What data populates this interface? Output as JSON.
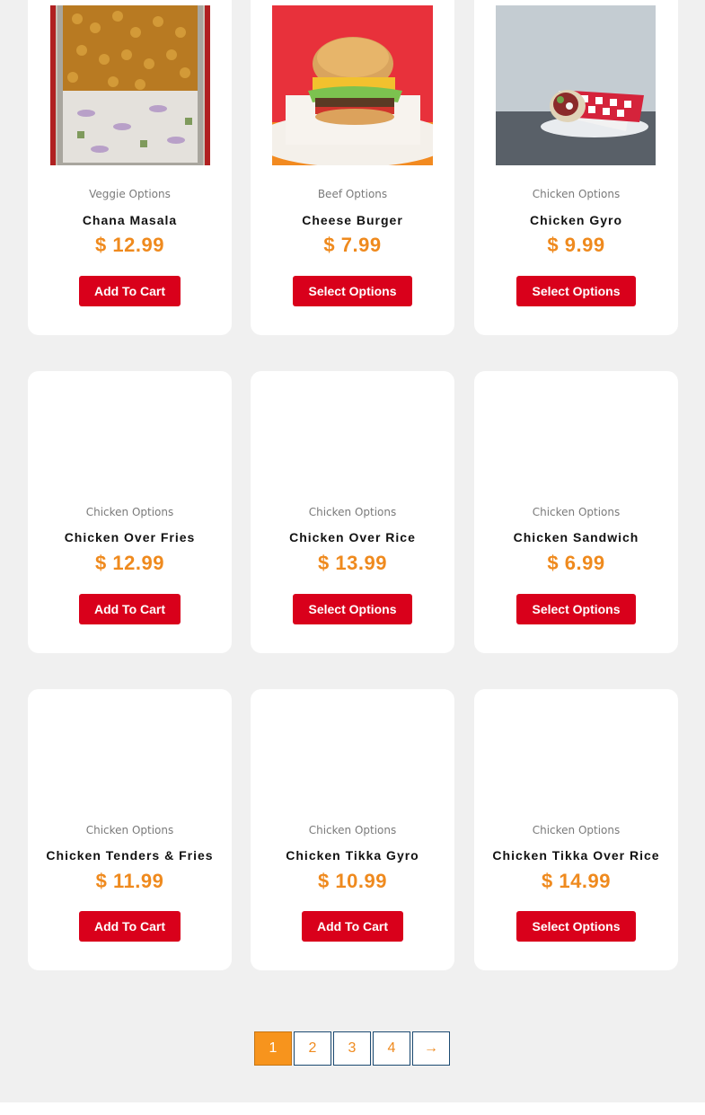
{
  "products": [
    {
      "category": "Veggie Options",
      "name": "Chana Masala",
      "price": "$ 12.99",
      "button": "Add To Cart",
      "button_type": "add",
      "image": "chana-masala-photo"
    },
    {
      "category": "Beef Options",
      "name": "Cheese Burger",
      "price": "$ 7.99",
      "button": "Select Options",
      "button_type": "select",
      "image": "cheese-burger-photo"
    },
    {
      "category": "Chicken Options",
      "name": "Chicken Gyro",
      "price": "$ 9.99",
      "button": "Select Options",
      "button_type": "select",
      "image": "chicken-gyro-photo"
    },
    {
      "category": "Chicken Options",
      "name": "Chicken Over Fries",
      "price": "$ 12.99",
      "button": "Add To Cart",
      "button_type": "add",
      "image": ""
    },
    {
      "category": "Chicken Options",
      "name": "Chicken Over Rice",
      "price": "$ 13.99",
      "button": "Select Options",
      "button_type": "select",
      "image": ""
    },
    {
      "category": "Chicken Options",
      "name": "Chicken Sandwich",
      "price": "$ 6.99",
      "button": "Select Options",
      "button_type": "select",
      "image": ""
    },
    {
      "category": "Chicken Options",
      "name": "Chicken Tenders & Fries",
      "price": "$ 11.99",
      "button": "Add To Cart",
      "button_type": "add",
      "image": ""
    },
    {
      "category": "Chicken Options",
      "name": "Chicken Tikka Gyro",
      "price": "$ 10.99",
      "button": "Add To Cart",
      "button_type": "add",
      "image": ""
    },
    {
      "category": "Chicken Options",
      "name": "Chicken Tikka Over Rice",
      "price": "$ 14.99",
      "button": "Select Options",
      "button_type": "select",
      "image": ""
    }
  ],
  "pagination": {
    "pages": [
      "1",
      "2",
      "3",
      "4"
    ],
    "current": "1",
    "next": "→"
  },
  "colors": {
    "accent_price": "#ef8a1e",
    "button": "#d9001b",
    "page_active": "#f7941d",
    "background": "#f0f0f0"
  }
}
